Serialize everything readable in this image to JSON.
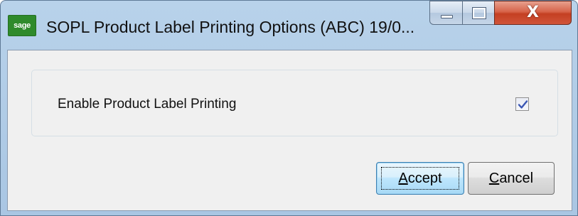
{
  "window": {
    "title": "SOPL Product Label Printing Options (ABC) 19/0...",
    "app_icon_text": "sage",
    "colors": {
      "title_bar": "#a9c6e3",
      "close_button": "#c43f22",
      "client_background": "#f0f0f0",
      "brand_green": "#2f8a2b"
    }
  },
  "caption_buttons": {
    "minimize_icon": "minimize-icon",
    "maximize_icon": "maximize-icon",
    "close_label": "X"
  },
  "options": {
    "enable_label": "Enable Product Label Printing",
    "enable_checked": true
  },
  "buttons": {
    "accept_mnemonic": "A",
    "accept_rest": "ccept",
    "cancel_mnemonic": "C",
    "cancel_rest": "ancel"
  }
}
